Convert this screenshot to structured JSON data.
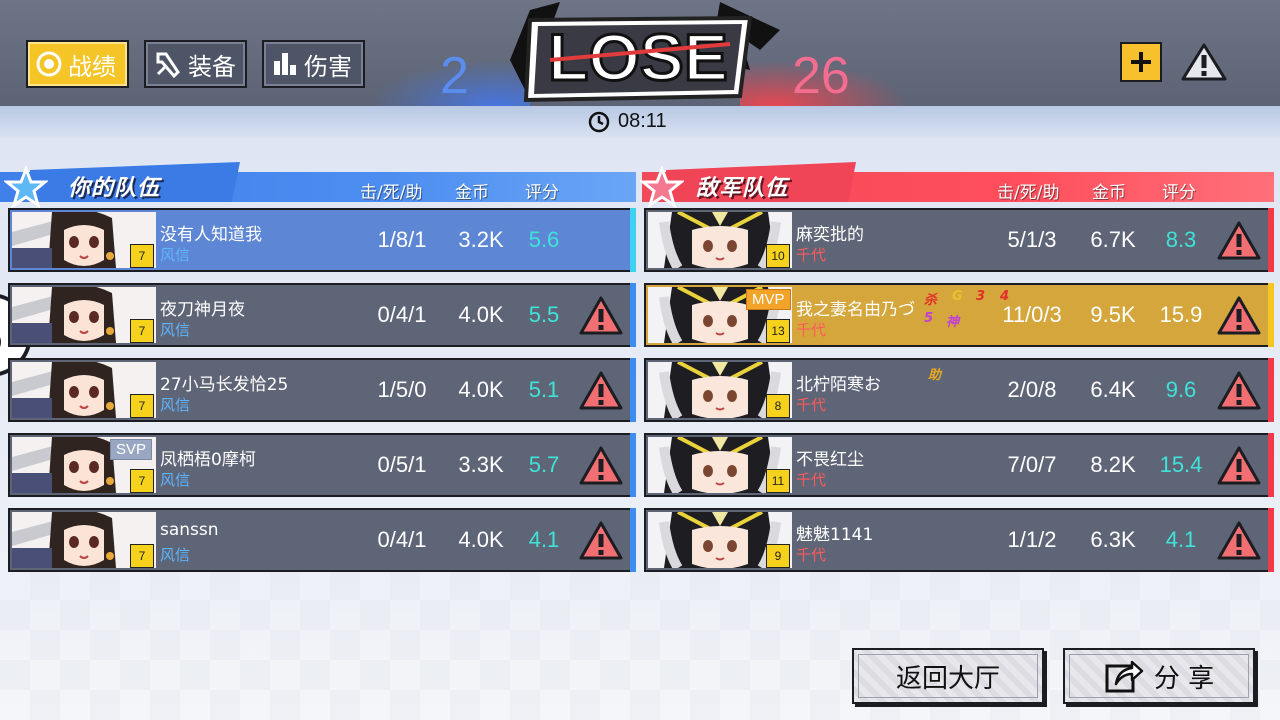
{
  "tabs": [
    {
      "label": "战绩",
      "icon": "record-icon",
      "active": true
    },
    {
      "label": "装备",
      "icon": "equipment-icon",
      "active": false
    },
    {
      "label": "伤害",
      "icon": "damage-chart-icon",
      "active": false
    }
  ],
  "result": {
    "text": "LOSE",
    "blue_score": "2",
    "red_score": "26"
  },
  "timer": {
    "icon": "clock-icon",
    "value": "08:11"
  },
  "top_actions": {
    "add_icon": "plus-icon",
    "report_icon": "warning-icon"
  },
  "columns": {
    "kda": "击/死/助",
    "gold": "金币",
    "rating": "评分"
  },
  "ally": {
    "title": "你的队伍",
    "players": [
      {
        "name": "没有人知道我",
        "hero": "风信",
        "level": "7",
        "kda": "1/8/1",
        "gold": "3.2K",
        "rating": "5.6",
        "rating_color": "cyan",
        "is_self": true,
        "badge": ""
      },
      {
        "name": "夜刀神月夜",
        "hero": "风信",
        "level": "7",
        "kda": "0/4/1",
        "gold": "4.0K",
        "rating": "5.5",
        "rating_color": "cyan",
        "is_self": false,
        "badge": ""
      },
      {
        "name": "27小马长发恰25",
        "hero": "风信",
        "level": "7",
        "kda": "1/5/0",
        "gold": "4.0K",
        "rating": "5.1",
        "rating_color": "cyan",
        "is_self": false,
        "badge": ""
      },
      {
        "name": "凤栖梧0摩柯",
        "hero": "风信",
        "level": "7",
        "kda": "0/5/1",
        "gold": "3.3K",
        "rating": "5.7",
        "rating_color": "cyan",
        "is_self": false,
        "badge": "SVP"
      },
      {
        "name": "sanssn",
        "hero": "风信",
        "level": "7",
        "kda": "0/4/1",
        "gold": "4.0K",
        "rating": "4.1",
        "rating_color": "cyan",
        "is_self": false,
        "badge": ""
      }
    ]
  },
  "enemy": {
    "title": "敌军队伍",
    "players": [
      {
        "name": "麻奕批的",
        "hero": "千代",
        "level": "10",
        "kda": "5/1/3",
        "gold": "6.7K",
        "rating": "8.3",
        "rating_color": "cyan",
        "badge": "",
        "achievements": []
      },
      {
        "name": "我之妻名由乃づ",
        "hero": "千代",
        "level": "13",
        "kda": "11/0/3",
        "gold": "9.5K",
        "rating": "15.9",
        "rating_color": "white",
        "badge": "MVP",
        "achievements": [
          "杀",
          "G",
          "3",
          "4",
          "5",
          "神"
        ]
      },
      {
        "name": "北柠陌寒お",
        "hero": "千代",
        "level": "8",
        "kda": "2/0/8",
        "gold": "6.4K",
        "rating": "9.6",
        "rating_color": "cyan",
        "badge": "",
        "achievements": [
          "助"
        ]
      },
      {
        "name": "不畏红尘",
        "hero": "千代",
        "level": "11",
        "kda": "7/0/7",
        "gold": "8.2K",
        "rating": "15.4",
        "rating_color": "cyan",
        "badge": "",
        "achievements": []
      },
      {
        "name": "魅魅1141",
        "hero": "千代",
        "level": "9",
        "kda": "1/1/2",
        "gold": "6.3K",
        "rating": "4.1",
        "rating_color": "cyan",
        "badge": "",
        "achievements": []
      }
    ]
  },
  "buttons": {
    "return_lobby": "返回大厅",
    "share": "分 享"
  },
  "colors": {
    "gold_tab": "#f5c426",
    "blue_team": "#3f80ea",
    "red_team": "#f04a5a",
    "rating_cyan": "#3fe3d8",
    "mvp_row": "#d4a63b",
    "self_row": "#5d86d4"
  }
}
